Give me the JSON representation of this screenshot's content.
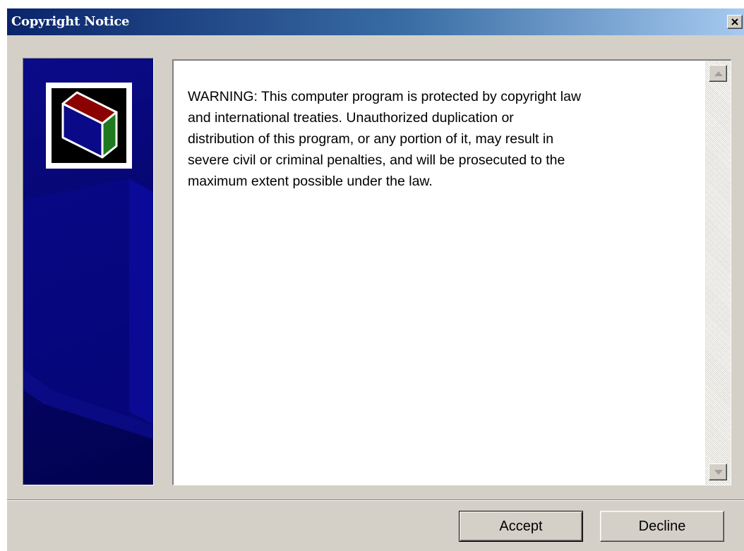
{
  "window": {
    "title": "Copyright Notice",
    "close_symbol": "×"
  },
  "side_panel": {
    "logo_icon": "book-box-icon"
  },
  "notice": {
    "text": "WARNING: This computer program is protected by copyright law\nand international treaties. Unauthorized duplication or\ndistribution of this program, or any portion of it, may result in\nsevere civil or criminal penalties, and will be prosecuted to the\nmaximum extent possible under the law."
  },
  "buttons": {
    "accept_label": "Accept",
    "decline_label": "Decline"
  },
  "colors": {
    "title_gradient_start": "#0a246a",
    "title_gradient_end": "#a6caf0",
    "side_panel": "#05056e",
    "dialog_face": "#d4d0c8"
  }
}
